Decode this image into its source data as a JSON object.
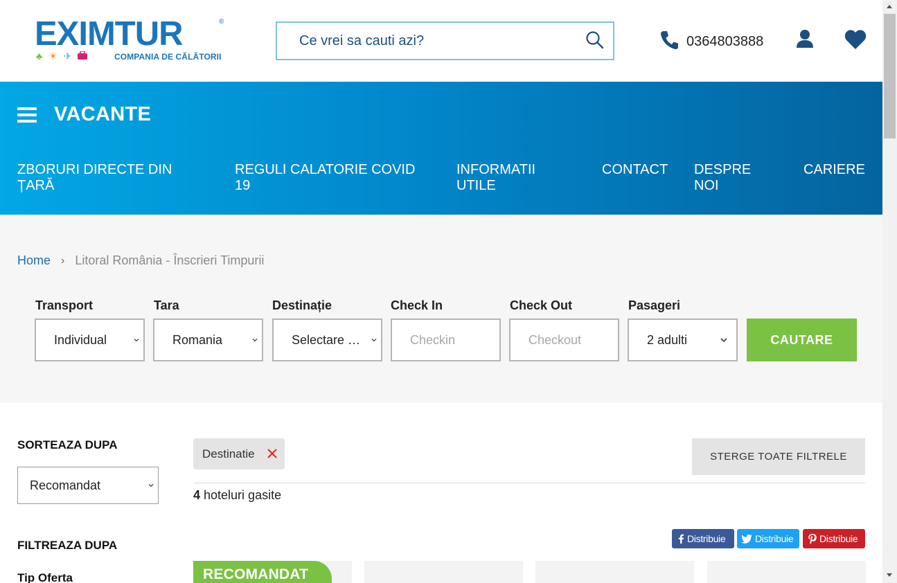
{
  "header": {
    "logo": {
      "word": "EXIMTUR",
      "reg": "®",
      "tagline": "COMPANIA DE CĂLĂTORII"
    },
    "search": {
      "placeholder": "Ce vrei sa cauti azi?"
    },
    "phone": "0364803888",
    "icons": [
      "search-icon",
      "phone-icon",
      "user-icon",
      "heart-icon"
    ]
  },
  "nav": {
    "menu_label": "VACANTE",
    "links": [
      "ZBORURI DIRECTE DIN ȚARĂ",
      "REGULI CALATORIE COVID 19",
      "INFORMATII UTILE",
      "CONTACT",
      "DESPRE NOI",
      "CARIERE"
    ]
  },
  "breadcrumb": {
    "home": "Home",
    "separator": "›",
    "current": "Litoral România - Înscrieri Timpurii"
  },
  "search_form": {
    "transport": {
      "label": "Transport",
      "value": "Individual"
    },
    "country": {
      "label": "Tara",
      "value": "Romania"
    },
    "destination": {
      "label": "Destinație",
      "value": "Selectare destinatie"
    },
    "checkin": {
      "label": "Check In",
      "placeholder": "Checkin"
    },
    "checkout": {
      "label": "Check Out",
      "placeholder": "Checkout"
    },
    "passengers": {
      "label": "Pasageri",
      "value": "2 adulti"
    },
    "submit": "CAUTARE"
  },
  "sidebar": {
    "sort_title": "SORTEAZA DUPA",
    "sort_value": "Recomandat",
    "filter_title": "FILTREAZA DUPA",
    "filter_group": "Tip Oferta"
  },
  "results": {
    "active_filter": "Destinatie",
    "clear_all": "STERGE TOATE FILTRELE",
    "count": "4",
    "count_label": " hoteluri gasite",
    "share": {
      "facebook": "Distribuie",
      "twitter": "Distribuie",
      "pinterest": "Distribuie"
    },
    "badge": "RECOMANDAT"
  },
  "colors": {
    "brand_blue": "#1b75bc",
    "nav_start": "#02a7e4",
    "nav_end": "#04649f",
    "green": "#7bc143",
    "facebook": "#3b5998",
    "twitter": "#1da1f2",
    "pinterest": "#cb2027"
  }
}
